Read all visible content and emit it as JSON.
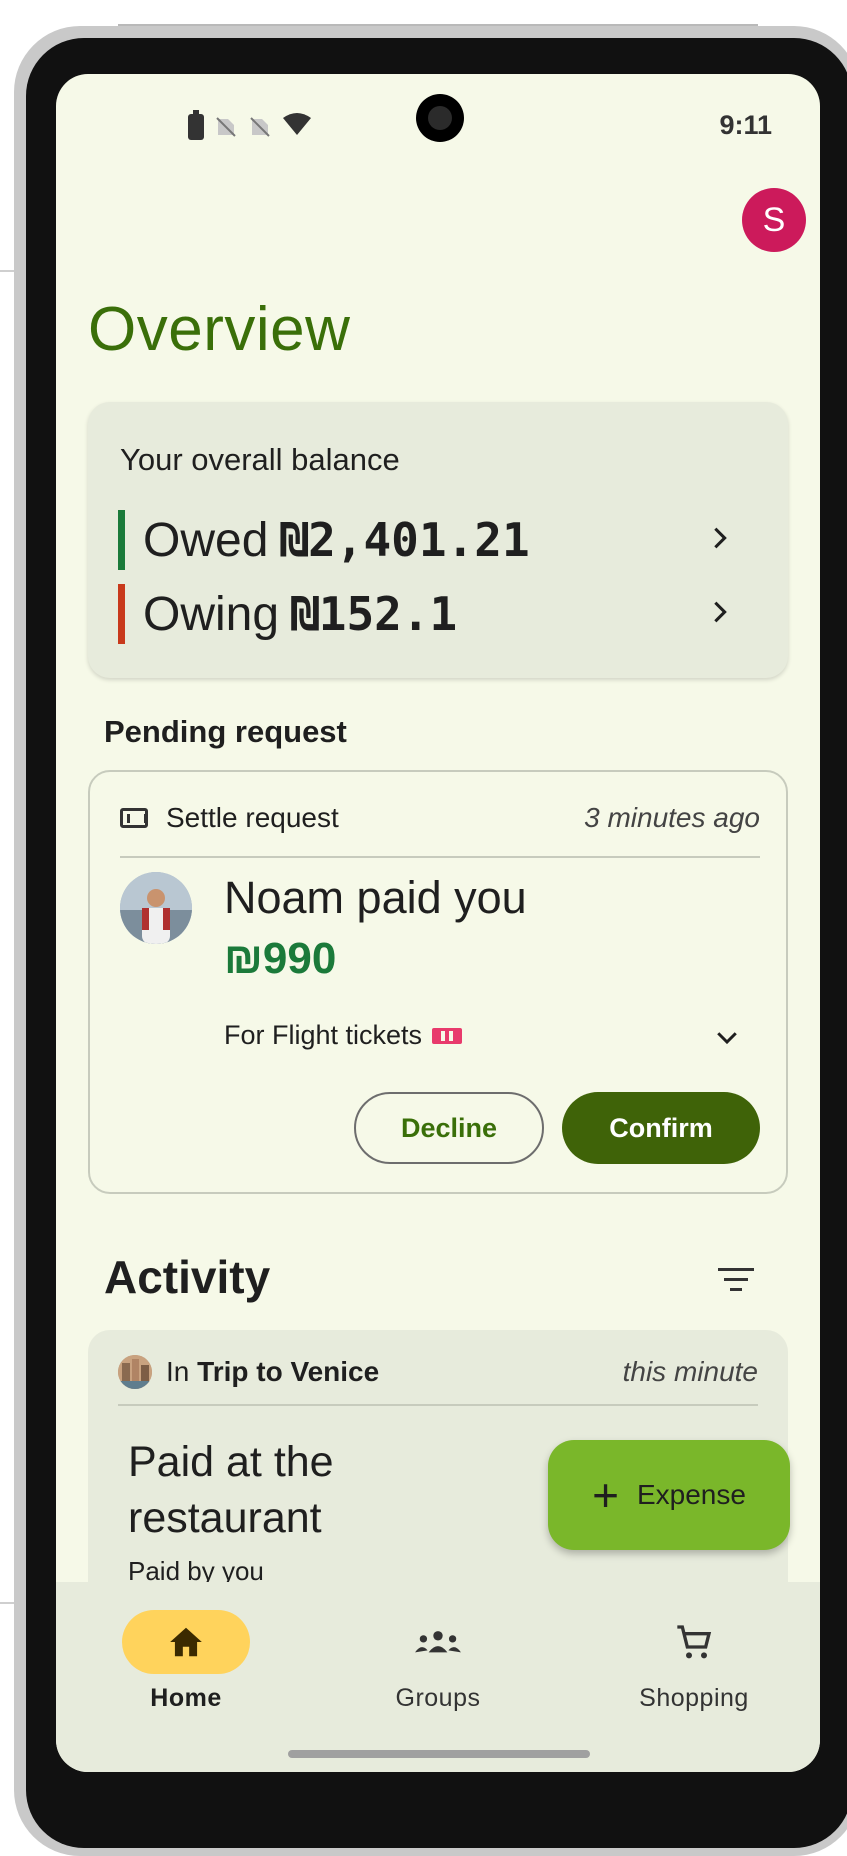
{
  "status_bar": {
    "time": "9:11"
  },
  "account": {
    "avatar_initial": "S",
    "avatar_color": "#cc1a5b"
  },
  "page": {
    "title": "Overview"
  },
  "balance": {
    "label": "Your overall balance",
    "owed_label": "Owed",
    "owed_amount": "₪2,401.21",
    "owing_label": "Owing",
    "owing_amount": "₪152.1",
    "owed_color": "#1b7a3a",
    "owing_color": "#c8391b"
  },
  "pending": {
    "section_title": "Pending request",
    "request_type": "Settle request",
    "time": "3 minutes ago",
    "title": "Noam paid you",
    "amount": "₪990",
    "for_text": "For Flight tickets",
    "decline_label": "Decline",
    "confirm_label": "Confirm"
  },
  "activity": {
    "section_title": "Activity",
    "in_prefix": "In",
    "group_name": "Trip to Venice",
    "time": "this minute",
    "title": "Paid at the restaurant",
    "paid_by": "Paid by you"
  },
  "fab": {
    "label": "Expense"
  },
  "nav": {
    "items": [
      {
        "label": "Home",
        "icon": "home-icon",
        "active": true
      },
      {
        "label": "Groups",
        "icon": "groups-icon",
        "active": false
      },
      {
        "label": "Shopping",
        "icon": "cart-icon",
        "active": false
      }
    ]
  },
  "colors": {
    "accent": "#3a6f09",
    "fab": "#7ab72a",
    "active_nav": "#ffd35c",
    "confirm": "#3f6308"
  }
}
